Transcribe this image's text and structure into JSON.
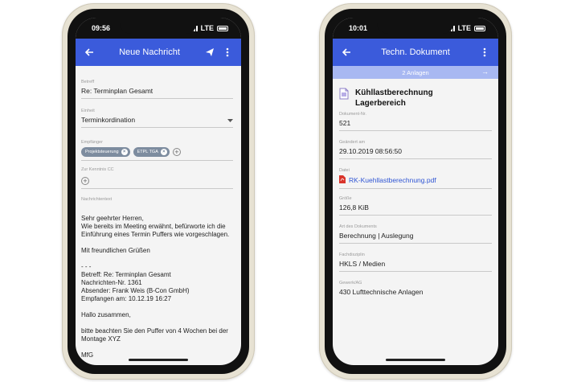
{
  "left": {
    "status": {
      "time": "09:56",
      "network": "LTE"
    },
    "appbar": {
      "title": "Neue Nachricht"
    },
    "subject": {
      "label": "Betreff",
      "value": "Re: Terminplan Gesamt"
    },
    "unit": {
      "label": "Einheit",
      "value": "Terminkordination"
    },
    "recipients": {
      "label": "Empfänger",
      "chips": [
        "Projektsteuerung",
        "ETPL TGA"
      ]
    },
    "cc": {
      "label": "Zur Kenntnis CC"
    },
    "message": {
      "label": "Nachrichtentext",
      "lines": [
        "Sehr geehrter Herren,",
        "Wie bereits im Meeting erwähnt, befürworte ich die Einführung eines Termin Puffers wie vorgeschlagen.",
        "",
        "Mit freundlichen Grüßen",
        "",
        "- - -",
        "Betreff: Re: Terminplan Gesamt",
        "Nachrichten-Nr. 1361",
        "Absender: Frank Weis (B-Con GmbH)",
        "Empfangen am: 10.12.19 16:27",
        "",
        "Hallo zusammen,",
        "",
        "bitte beachten Sie den Puffer von 4 Wochen bei der Montage XYZ",
        "",
        "MfG"
      ]
    }
  },
  "right": {
    "status": {
      "time": "10:01",
      "network": "LTE"
    },
    "appbar": {
      "title": "Techn. Dokument"
    },
    "attachments": {
      "label": "2 Anlagen"
    },
    "doc": {
      "title_line1": "Kühllastberechnung",
      "title_line2": "Lagerbereich"
    },
    "fields": [
      {
        "label": "Dokument-Nr.",
        "value": "521",
        "link": false
      },
      {
        "label": "Geändert am",
        "value": "29.10.2019 08:56:50",
        "link": false
      },
      {
        "label": "Datei",
        "value": "RK-Kuehllastberechnung.pdf",
        "link": true
      },
      {
        "label": "Größe",
        "value": "126,8 KiB",
        "link": false
      },
      {
        "label": "Art des Dokuments",
        "value": "Berechnung | Auslegung",
        "link": false
      },
      {
        "label": "Fachdisziplin",
        "value": "HKLS / Medien",
        "link": false
      },
      {
        "label": "Gewerk/AG",
        "value": "430 Lufttechnische Anlagen",
        "link": false
      }
    ]
  },
  "colors": {
    "appbar": "#3b5bdb",
    "banner": "#a8b8f2",
    "chip": "#7d8c9f",
    "link": "#2f55d4",
    "pdf": "#d9342b"
  }
}
